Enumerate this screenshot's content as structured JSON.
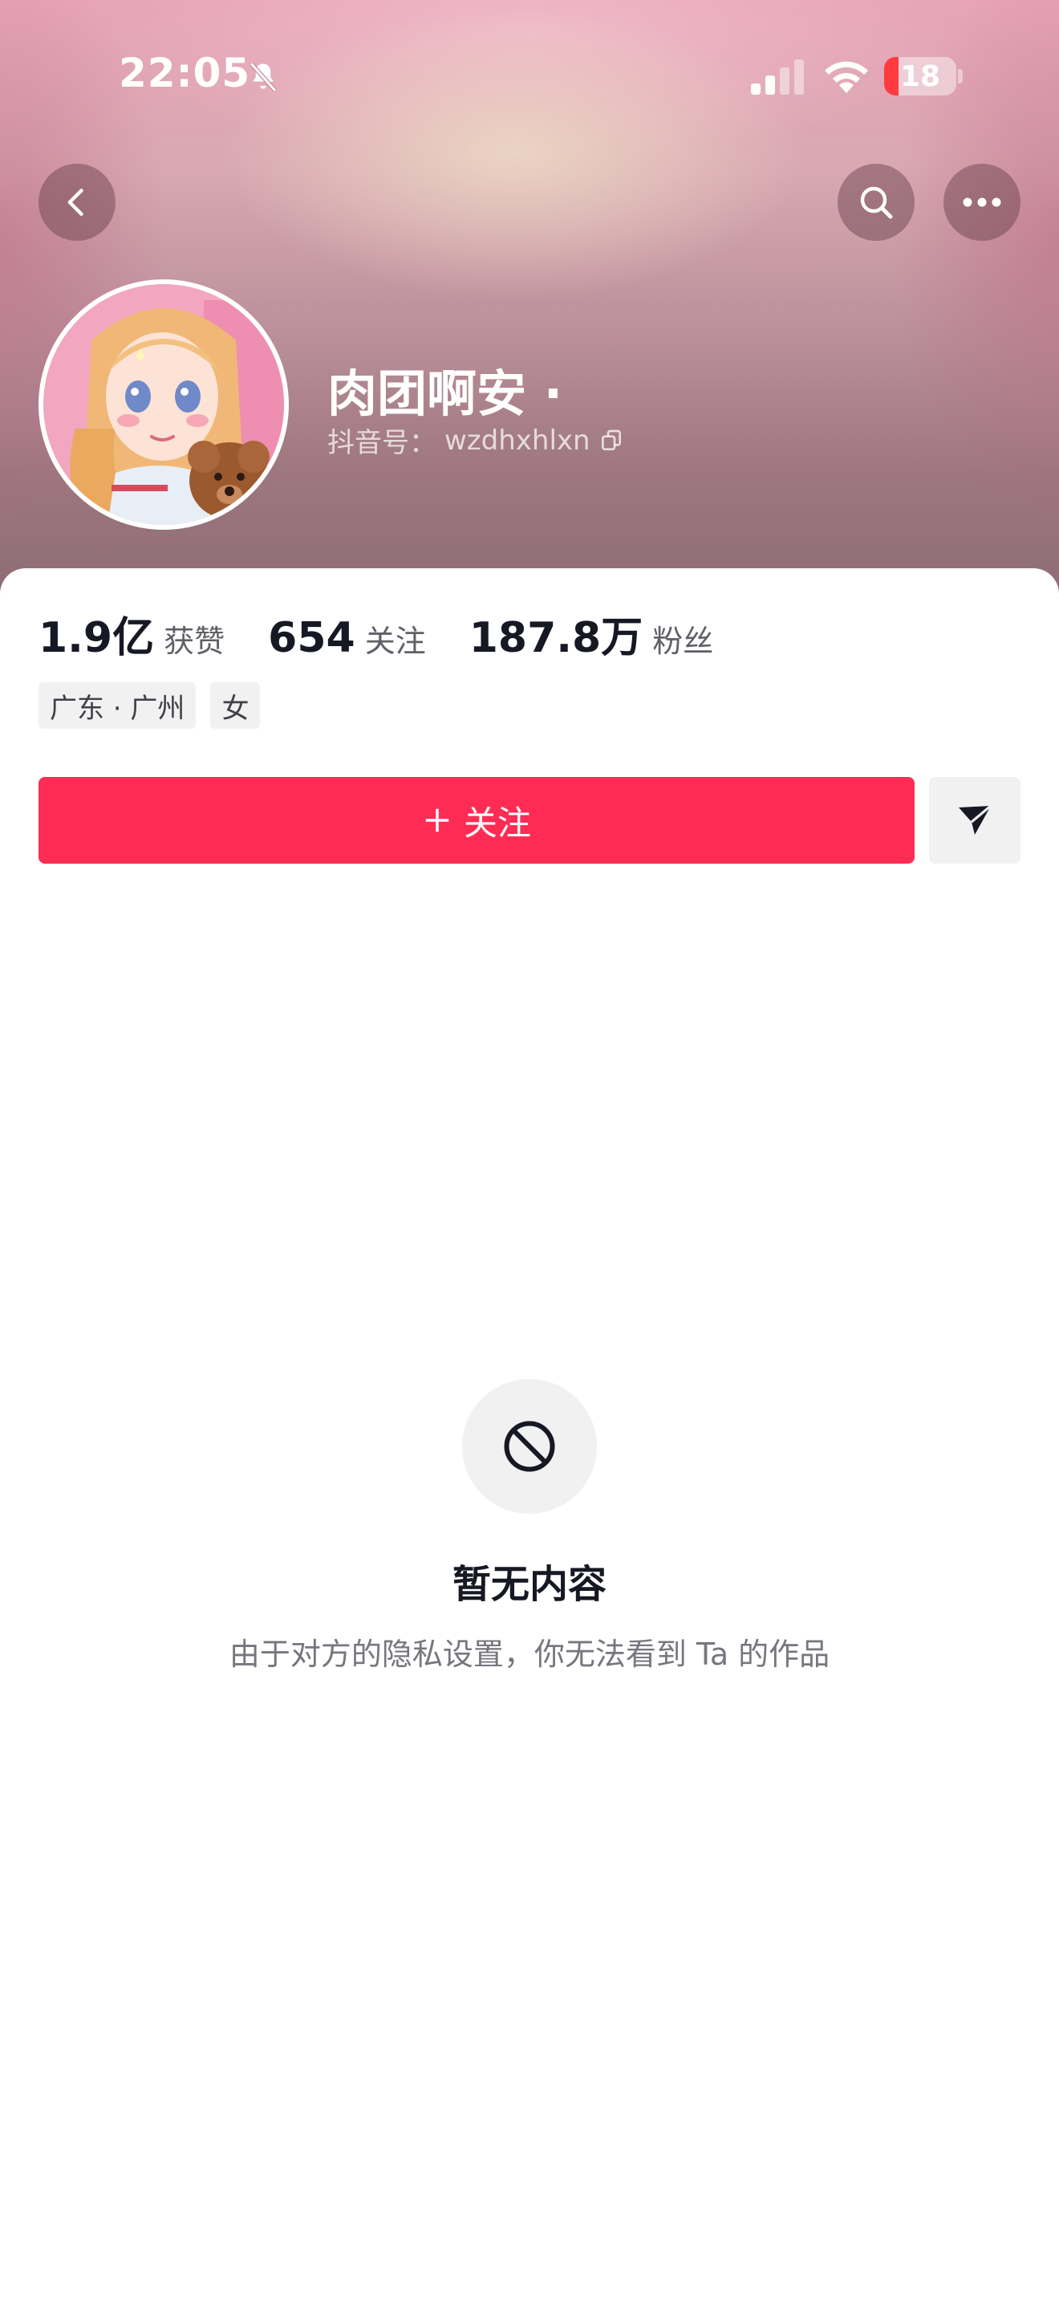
{
  "status_bar": {
    "time": "22:05",
    "battery": "18",
    "icons": [
      "bell-muted-icon",
      "cellular-signal-icon",
      "wifi-icon",
      "battery-icon"
    ]
  },
  "nav": {
    "back_icon": "chevron-left-icon",
    "search_icon": "search-icon",
    "more_icon": "more-dots-icon"
  },
  "profile": {
    "name": "肉团啊安 ·",
    "id_label": "抖音号：",
    "id_value": "wzdhxhlxn",
    "copy_icon": "copy-icon"
  },
  "stats": [
    {
      "value": "1.9亿",
      "label": "获赞"
    },
    {
      "value": "654",
      "label": "关注"
    },
    {
      "value": "187.8万",
      "label": "粉丝"
    }
  ],
  "tags": [
    "广东 · 广州",
    "女"
  ],
  "actions": {
    "follow_label": "关注",
    "follow_icon": "plus-icon",
    "share_icon": "send-icon"
  },
  "empty_state": {
    "icon": "ban-icon",
    "title": "暂无内容",
    "description": "由于对方的隐私设置，你无法看到 Ta 的作品"
  },
  "colors": {
    "accent": "#fe2c55",
    "text_primary": "#161823",
    "text_secondary": "#76777e"
  }
}
